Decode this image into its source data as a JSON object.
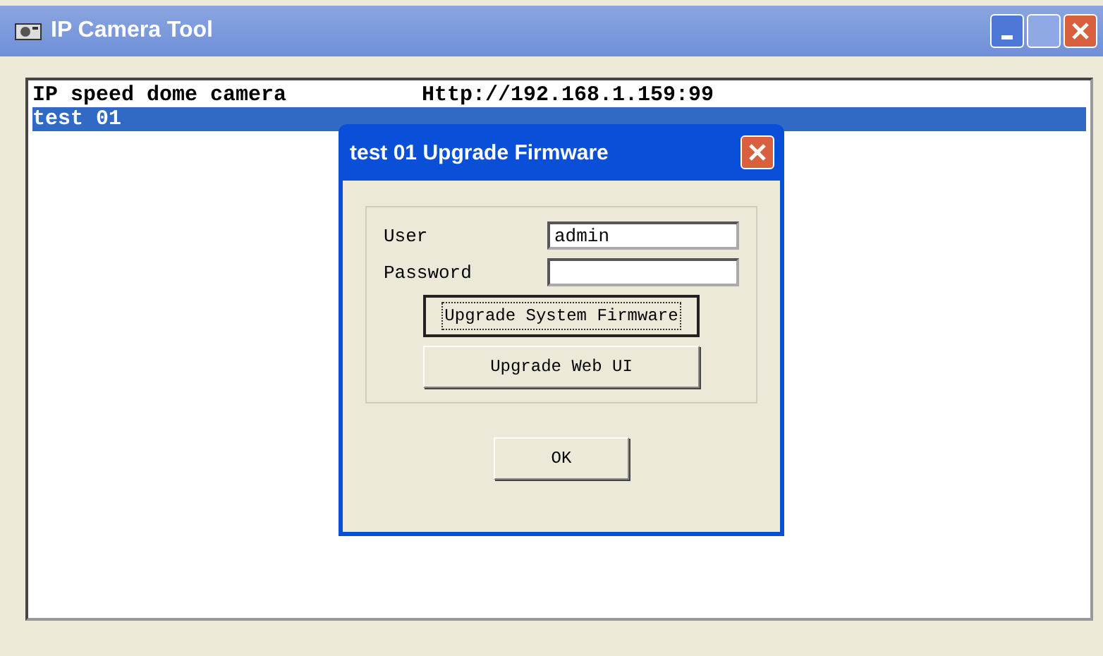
{
  "window": {
    "title": "IP Camera Tool"
  },
  "cameras": [
    {
      "name": "IP speed dome camera",
      "address": "Http://192.168.1.159:99",
      "selected": false
    },
    {
      "name": "test 01",
      "selected": true
    }
  ],
  "dialog": {
    "title": "test 01 Upgrade Firmware",
    "fields": [
      {
        "label": "User",
        "value": "admin"
      },
      {
        "label": "Password"
      }
    ],
    "buttons": [
      {
        "label": "Upgrade System Firmware",
        "focused": true
      },
      {
        "label": "Upgrade Web UI",
        "focused": false
      }
    ],
    "ok": "OK"
  }
}
